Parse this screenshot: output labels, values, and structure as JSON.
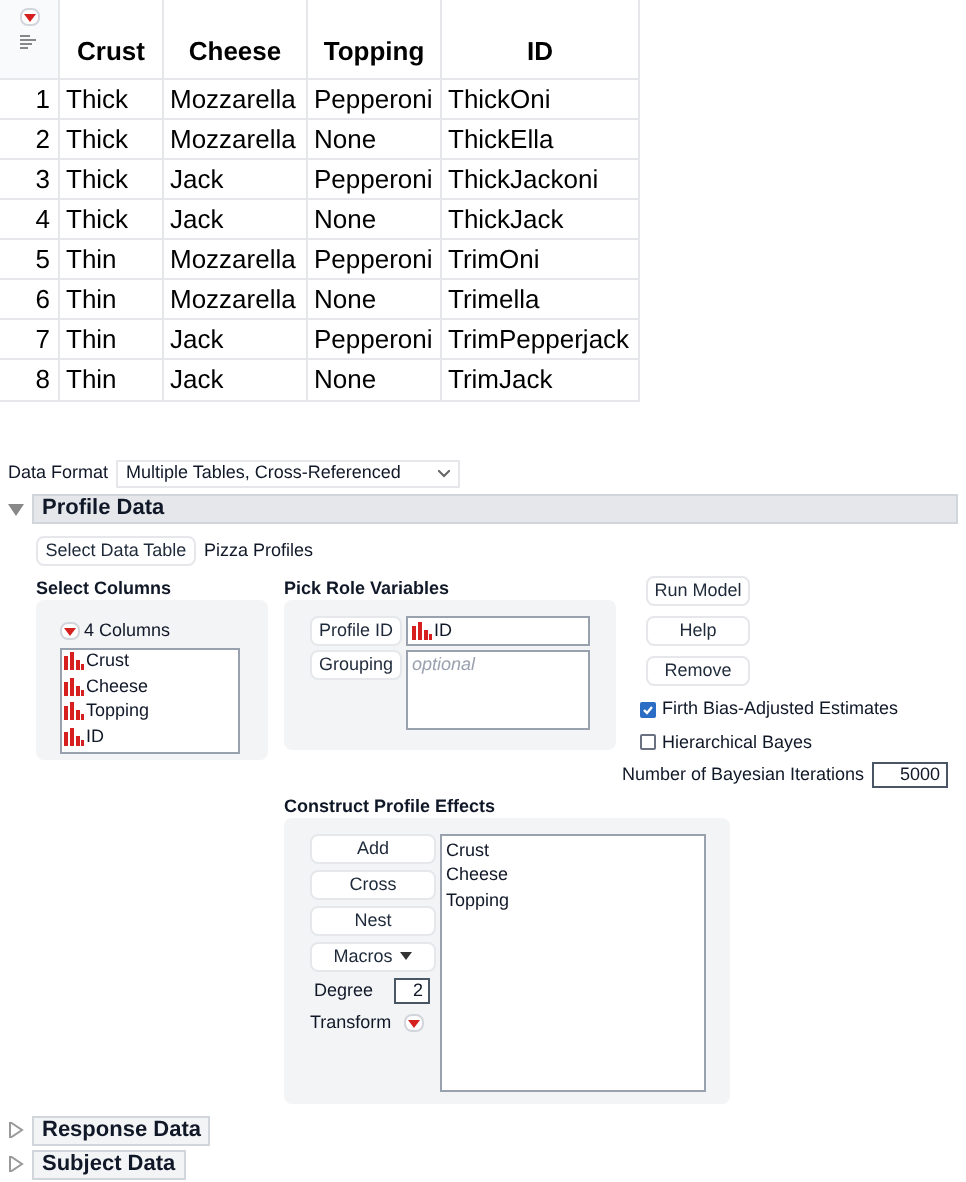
{
  "table": {
    "columns": [
      "Crust",
      "Cheese",
      "Topping",
      "ID"
    ],
    "rows": [
      {
        "number": "1",
        "cells": [
          "Thick",
          "Mozzarella",
          "Pepperoni",
          "ThickOni"
        ]
      },
      {
        "number": "2",
        "cells": [
          "Thick",
          "Mozzarella",
          "None",
          "ThickElla"
        ]
      },
      {
        "number": "3",
        "cells": [
          "Thick",
          "Jack",
          "Pepperoni",
          "ThickJackoni"
        ]
      },
      {
        "number": "4",
        "cells": [
          "Thick",
          "Jack",
          "None",
          "ThickJack"
        ]
      },
      {
        "number": "5",
        "cells": [
          "Thin",
          "Mozzarella",
          "Pepperoni",
          "TrimOni"
        ]
      },
      {
        "number": "6",
        "cells": [
          "Thin",
          "Mozzarella",
          "None",
          "Trimella"
        ]
      },
      {
        "number": "7",
        "cells": [
          "Thin",
          "Jack",
          "Pepperoni",
          "TrimPepperjack"
        ]
      },
      {
        "number": "8",
        "cells": [
          "Thin",
          "Jack",
          "None",
          "TrimJack"
        ]
      }
    ]
  },
  "data_format": {
    "label": "Data Format",
    "value": "Multiple Tables, Cross-Referenced"
  },
  "profile_data": {
    "title": "Profile Data",
    "expanded": true,
    "select_table": {
      "button": "Select Data Table",
      "value": "Pizza Profiles"
    },
    "select_columns": {
      "title": "Select Columns",
      "count": "4 Columns",
      "items": [
        "Crust",
        "Cheese",
        "Topping",
        "ID"
      ]
    },
    "roles": {
      "title": "Pick Role Variables",
      "items": [
        {
          "button": "Profile ID",
          "values": [
            "ID"
          ]
        },
        {
          "button": "Grouping",
          "placeholder": "optional"
        }
      ]
    },
    "actions": [
      "Run Model",
      "Help",
      "Remove"
    ],
    "options": [
      {
        "label": "Firth Bias-Adjusted Estimates",
        "checked": true
      },
      {
        "label": "Hierarchical Bayes",
        "checked": false
      }
    ],
    "iterations": {
      "label": "Number of Bayesian Iterations",
      "value": "5000"
    },
    "effects": {
      "title": "Construct Profile Effects",
      "buttons": [
        {
          "kind": "button",
          "label": "Add"
        },
        {
          "kind": "button",
          "label": "Cross"
        },
        {
          "kind": "button",
          "label": "Nest"
        },
        {
          "kind": "menu",
          "label": "Macros"
        }
      ],
      "degree": {
        "label": "Degree",
        "value": "2"
      },
      "transform": "Transform",
      "items": [
        "Crust",
        "Cheese",
        "Topping"
      ]
    }
  },
  "sections": [
    {
      "title": "Response Data",
      "expanded": false
    },
    {
      "title": "Subject Data",
      "expanded": false
    }
  ]
}
